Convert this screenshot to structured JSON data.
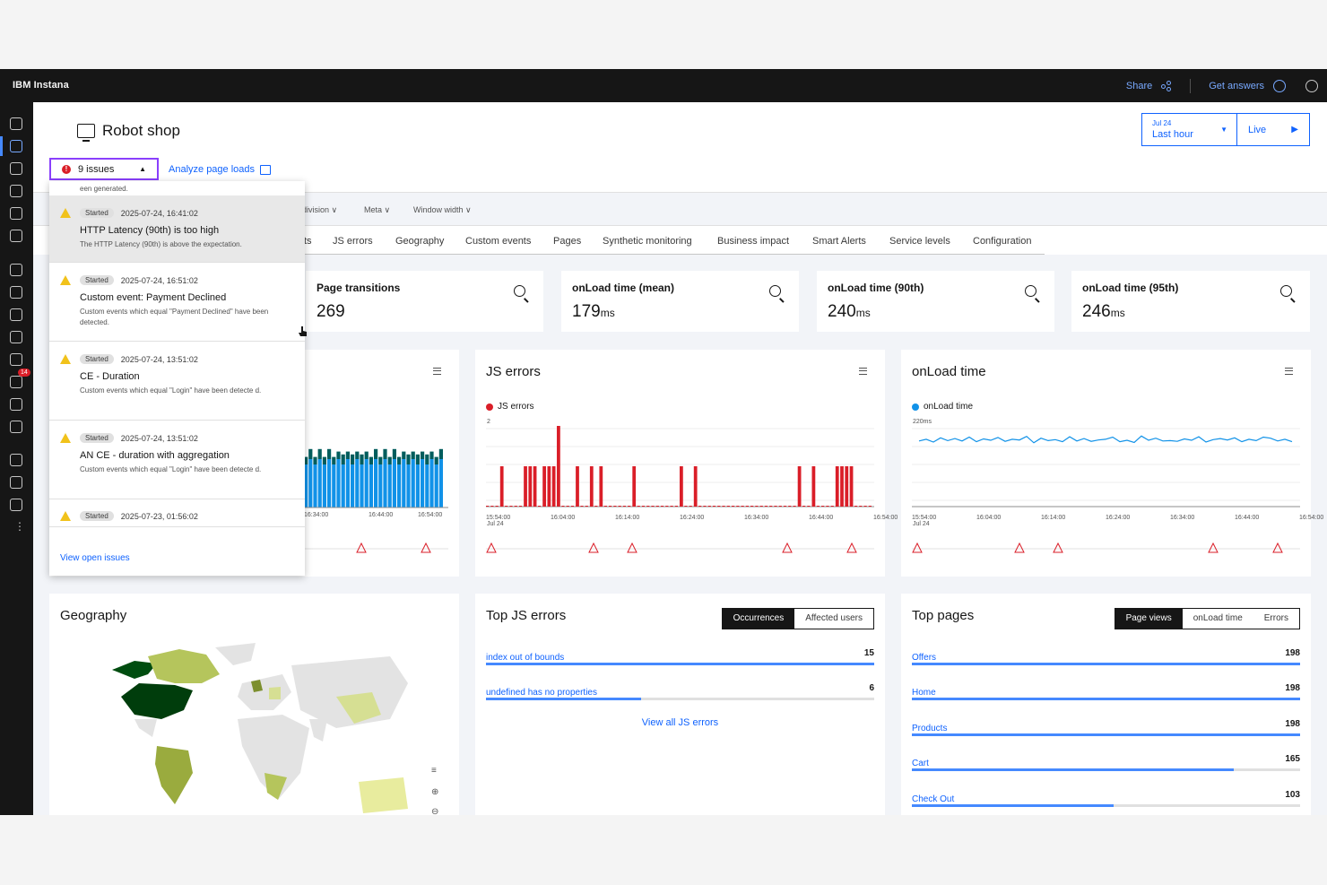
{
  "topbar": {
    "brand": "IBM Instana",
    "share": "Share",
    "get_answers": "Get answers"
  },
  "sidebar": {
    "alert_badge": "14"
  },
  "header": {
    "title": "Robot shop",
    "issues_label": "9 issues",
    "analyze_label": "Analyze page loads",
    "timepicker": {
      "date": "Jul 24",
      "range": "Last hour",
      "live": "Live"
    }
  },
  "filters": [
    "division ∨",
    "Meta ∨",
    "Window width ∨"
  ],
  "tabs": [
    "ts",
    "JS errors",
    "Geography",
    "Custom events",
    "Pages",
    "Synthetic monitoring",
    "Business impact",
    "Smart Alerts",
    "Service levels",
    "Configuration"
  ],
  "kpis": [
    {
      "title": "Page transitions",
      "value": "269",
      "unit": ""
    },
    {
      "title": "onLoad time (mean)",
      "value": "179",
      "unit": "ms"
    },
    {
      "title": "onLoad time (90th)",
      "value": "240",
      "unit": "ms"
    },
    {
      "title": "onLoad time (95th)",
      "value": "246",
      "unit": "ms"
    }
  ],
  "issues_dropdown": {
    "truncated_text": "een generated.",
    "items": [
      {
        "status": "Started",
        "time": "2025-07-24, 16:41:02",
        "title": "HTTP Latency (90th) is too high",
        "desc": "The HTTP Latency (90th) is above the expectation."
      },
      {
        "status": "Started",
        "time": "2025-07-24, 16:51:02",
        "title": "Custom event: Payment Declined",
        "desc": "Custom events which equal \"Payment Declined\" have been detected."
      },
      {
        "status": "Started",
        "time": "2025-07-24, 13:51:02",
        "title": "CE - Duration",
        "desc": "Custom events which equal \"Login\" have been detecte d."
      },
      {
        "status": "Started",
        "time": "2025-07-24, 13:51:02",
        "title": "AN CE - duration with aggregation",
        "desc": "Custom events which equal \"Login\" have been detecte d."
      },
      {
        "status": "Started",
        "time": "2025-07-23, 01:56:02",
        "title": "",
        "desc": ""
      }
    ],
    "footer": "View open issues"
  },
  "charts": {
    "left_ticks": [
      "16:34:00",
      "16:44:00",
      "16:54:00"
    ],
    "js_errors": {
      "title": "JS errors",
      "legend": "JS errors",
      "ymax_label": "2",
      "xticks": [
        "15:54:00",
        "16:04:00",
        "16:14:00",
        "16:24:00",
        "16:34:00",
        "16:44:00",
        "16:54:00"
      ],
      "xsub": "Jul 24"
    },
    "onload": {
      "title": "onLoad time",
      "legend": "onLoad time",
      "ymax_label": "220ms",
      "xticks": [
        "15:54:00",
        "16:04:00",
        "16:14:00",
        "16:24:00",
        "16:34:00",
        "16:44:00",
        "16:54:00"
      ],
      "xsub": "Jul 24"
    }
  },
  "chart_data": [
    {
      "type": "bar",
      "title": "",
      "series": [
        {
          "name": "",
          "values": [
            0.8,
            0.9,
            0.8,
            0.9,
            0.8,
            0.9,
            0.8,
            0.9,
            0.8,
            0.9,
            0.8,
            0.9,
            0.8,
            0.9,
            0.8,
            0.9,
            0.8,
            0.9,
            0.8,
            0.9,
            0.8,
            0.9,
            0.8,
            0.9,
            0.8,
            0.9,
            0.8,
            0.9,
            0.8,
            0.9
          ]
        },
        {
          "name": "",
          "values": [
            0.3,
            0.4,
            0.3,
            0.4,
            0.3,
            0.4,
            0.3,
            0.3,
            0.4,
            0.3,
            0.4,
            0.3,
            0.4,
            0.3,
            0.3,
            0.4,
            0.3,
            0.4,
            0.3,
            0.4,
            0.3,
            0.3,
            0.4,
            0.3,
            0.4,
            0.3,
            0.4,
            0.3,
            0.3,
            0.4
          ]
        }
      ]
    },
    {
      "type": "bar",
      "title": "JS errors",
      "ylim": [
        0,
        2
      ],
      "series": [
        {
          "name": "JS errors",
          "values": [
            0,
            0,
            0,
            1,
            0,
            0,
            0,
            0,
            1,
            1,
            1,
            0,
            1,
            1,
            1,
            2,
            0,
            0,
            0,
            1,
            0,
            0,
            1,
            0,
            1,
            0,
            0,
            0,
            0,
            0,
            0,
            1,
            0,
            0,
            0,
            0,
            0,
            0,
            0,
            0,
            0,
            1,
            0,
            0,
            1,
            0,
            0,
            0,
            0,
            0,
            0,
            0,
            0,
            0,
            0,
            0,
            0,
            0,
            0,
            0,
            0,
            0,
            0,
            0,
            0,
            0,
            1,
            0,
            0,
            1,
            0,
            0,
            0,
            0,
            1,
            1,
            1,
            1,
            0,
            0,
            0,
            0
          ]
        }
      ]
    },
    {
      "type": "line",
      "title": "onLoad time",
      "series": [
        {
          "name": "onLoad time",
          "values": [
            185,
            190,
            182,
            194,
            186,
            192,
            185,
            196,
            183,
            191,
            187,
            195,
            184,
            190,
            188,
            198,
            180,
            193,
            186,
            189,
            183,
            197,
            185,
            192,
            184,
            188,
            190,
            196,
            183,
            187,
            181,
            199,
            187,
            193,
            185,
            186,
            184,
            191,
            187,
            197,
            182,
            189,
            192,
            188,
            194,
            183,
            190,
            186,
            196,
            193,
            185,
            190,
            183
          ]
        }
      ]
    }
  ],
  "top_js_errors": {
    "title": "Top JS errors",
    "toggle": [
      "Occurrences",
      "Affected users"
    ],
    "rows": [
      {
        "label": "index out of bounds",
        "value": 15,
        "pct": 1.0
      },
      {
        "label": "undefined has no properties",
        "value": 6,
        "pct": 0.4
      }
    ],
    "view_all": "View all JS errors"
  },
  "top_pages": {
    "title": "Top pages",
    "toggle": [
      "Page views",
      "onLoad time",
      "Errors"
    ],
    "rows": [
      {
        "label": "Offers",
        "value": 198,
        "pct": 1.0
      },
      {
        "label": "Home",
        "value": 198,
        "pct": 1.0
      },
      {
        "label": "Products",
        "value": 198,
        "pct": 1.0
      },
      {
        "label": "Cart",
        "value": 165,
        "pct": 0.83
      },
      {
        "label": "Check Out",
        "value": 103,
        "pct": 0.52
      }
    ]
  },
  "geography": {
    "title": "Geography"
  },
  "colors": {
    "accent": "#0f62fe",
    "error": "#da1e28",
    "bar_dark": "#005d5d",
    "bar_blue": "#1192e8"
  }
}
